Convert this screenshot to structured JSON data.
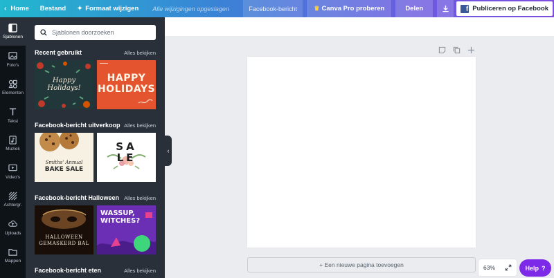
{
  "topbar": {
    "home": "Home",
    "file": "Bestand",
    "resize": "Formaat wijzigen",
    "saved": "Alle wijzigingen opgeslagen",
    "doc_title": "Facebook-bericht",
    "pro": "Canva Pro proberen",
    "share": "Delen",
    "publish": "Publiceren op Facebook"
  },
  "rail": {
    "items": [
      {
        "label": "Sjablonen",
        "icon": "templates-icon"
      },
      {
        "label": "Foto's",
        "icon": "photos-icon"
      },
      {
        "label": "Elementen",
        "icon": "elements-icon"
      },
      {
        "label": "Tekst",
        "icon": "text-icon"
      },
      {
        "label": "Muziek",
        "icon": "music-icon"
      },
      {
        "label": "Video's",
        "icon": "video-icon"
      },
      {
        "label": "Achtergr.",
        "icon": "background-icon"
      },
      {
        "label": "Uploads",
        "icon": "upload-icon"
      },
      {
        "label": "Mappen",
        "icon": "folder-icon"
      }
    ]
  },
  "panel": {
    "search_placeholder": "Sjablonen doorzoeken",
    "sections": [
      {
        "title": "Recent gebruikt",
        "link": "Alles bekijken",
        "thumbs": [
          {
            "lines": [
              "Happy",
              "Holidays!"
            ]
          },
          {
            "lines": [
              "HAPPY",
              "HOLIDAYS"
            ]
          }
        ]
      },
      {
        "title": "Facebook-bericht uitverkoop",
        "link": "Alles bekijken",
        "thumbs": [
          {
            "lines": [
              "Smiths' Annual",
              "BAKE SALE"
            ]
          },
          {
            "lines": [
              "SA",
              "LE"
            ]
          }
        ]
      },
      {
        "title": "Facebook-bericht Halloween",
        "link": "Alles bekijken",
        "thumbs": [
          {
            "lines": [
              "HALLOWEEN",
              "GEMASKERD BAL"
            ]
          },
          {
            "lines": [
              "WASSUP,",
              "WITCHES?"
            ]
          }
        ]
      },
      {
        "title": "Facebook-bericht eten",
        "link": "Alles bekijken"
      }
    ]
  },
  "canvas": {
    "add_page": "+ Een nieuwe pagina toevoegen",
    "zoom": "63%",
    "help": "Help",
    "help_q": "?"
  },
  "colors": {
    "accent": "#7d2ae8",
    "rail_bg": "#0e1318",
    "panel_bg": "#293039"
  }
}
